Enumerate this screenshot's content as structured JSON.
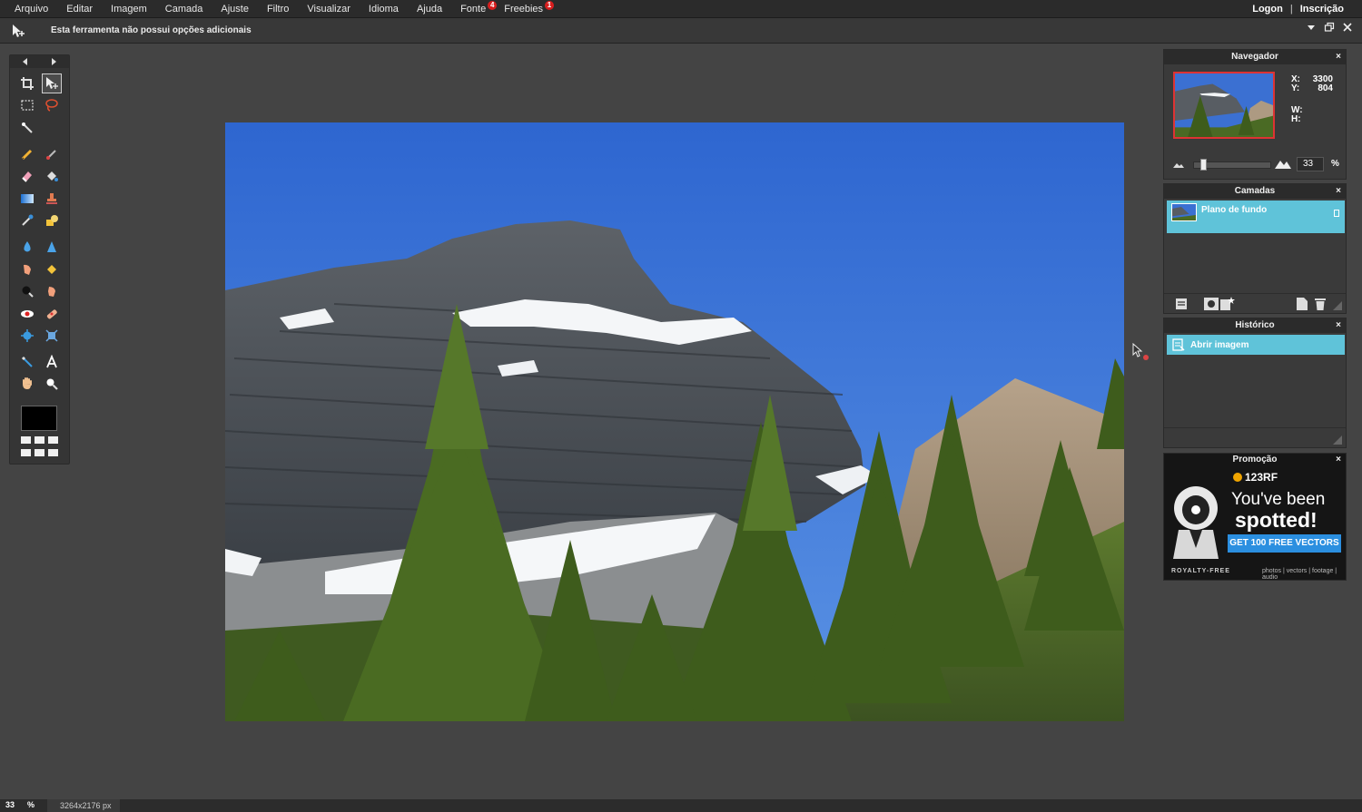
{
  "menubar": {
    "items": [
      {
        "label": "Arquivo"
      },
      {
        "label": "Editar"
      },
      {
        "label": "Imagem"
      },
      {
        "label": "Camada"
      },
      {
        "label": "Ajuste"
      },
      {
        "label": "Filtro"
      },
      {
        "label": "Visualizar"
      },
      {
        "label": "Idioma"
      },
      {
        "label": "Ajuda"
      },
      {
        "label": "Fonte",
        "badge": "4"
      },
      {
        "label": "Freebies",
        "badge": "1"
      }
    ],
    "login": "Logon",
    "separator": "|",
    "signup": "Inscrição"
  },
  "options_bar": {
    "message": "Esta ferramenta não possui opções adicionais"
  },
  "navigator": {
    "title": "Navegador",
    "x_label": "X:",
    "x_value": "3300",
    "y_label": "Y:",
    "y_value": "804",
    "w_label": "W:",
    "h_label": "H:",
    "zoom_value": "33",
    "zoom_unit": "%",
    "close": "×"
  },
  "layers": {
    "title": "Camadas",
    "layer_name": "Plano de fundo",
    "close": "×"
  },
  "history": {
    "title": "Histórico",
    "entry": "Abrir imagem",
    "close": "×"
  },
  "promo": {
    "title": "Promoção",
    "brand": "123RF",
    "line1": "You've been",
    "line2": "spotted!",
    "cta": "GET 100 FREE VECTORS",
    "royalty": "ROYALTY-FREE",
    "media": "photos | vectors | footage | audio",
    "close": "×"
  },
  "statusbar": {
    "zoom": "33",
    "unit": "%",
    "dimensions": "3264x2176 px"
  },
  "colors": {
    "accent_selection": "#5fc3d9",
    "badge": "#d81e1e",
    "foreground_color": "#000000"
  }
}
